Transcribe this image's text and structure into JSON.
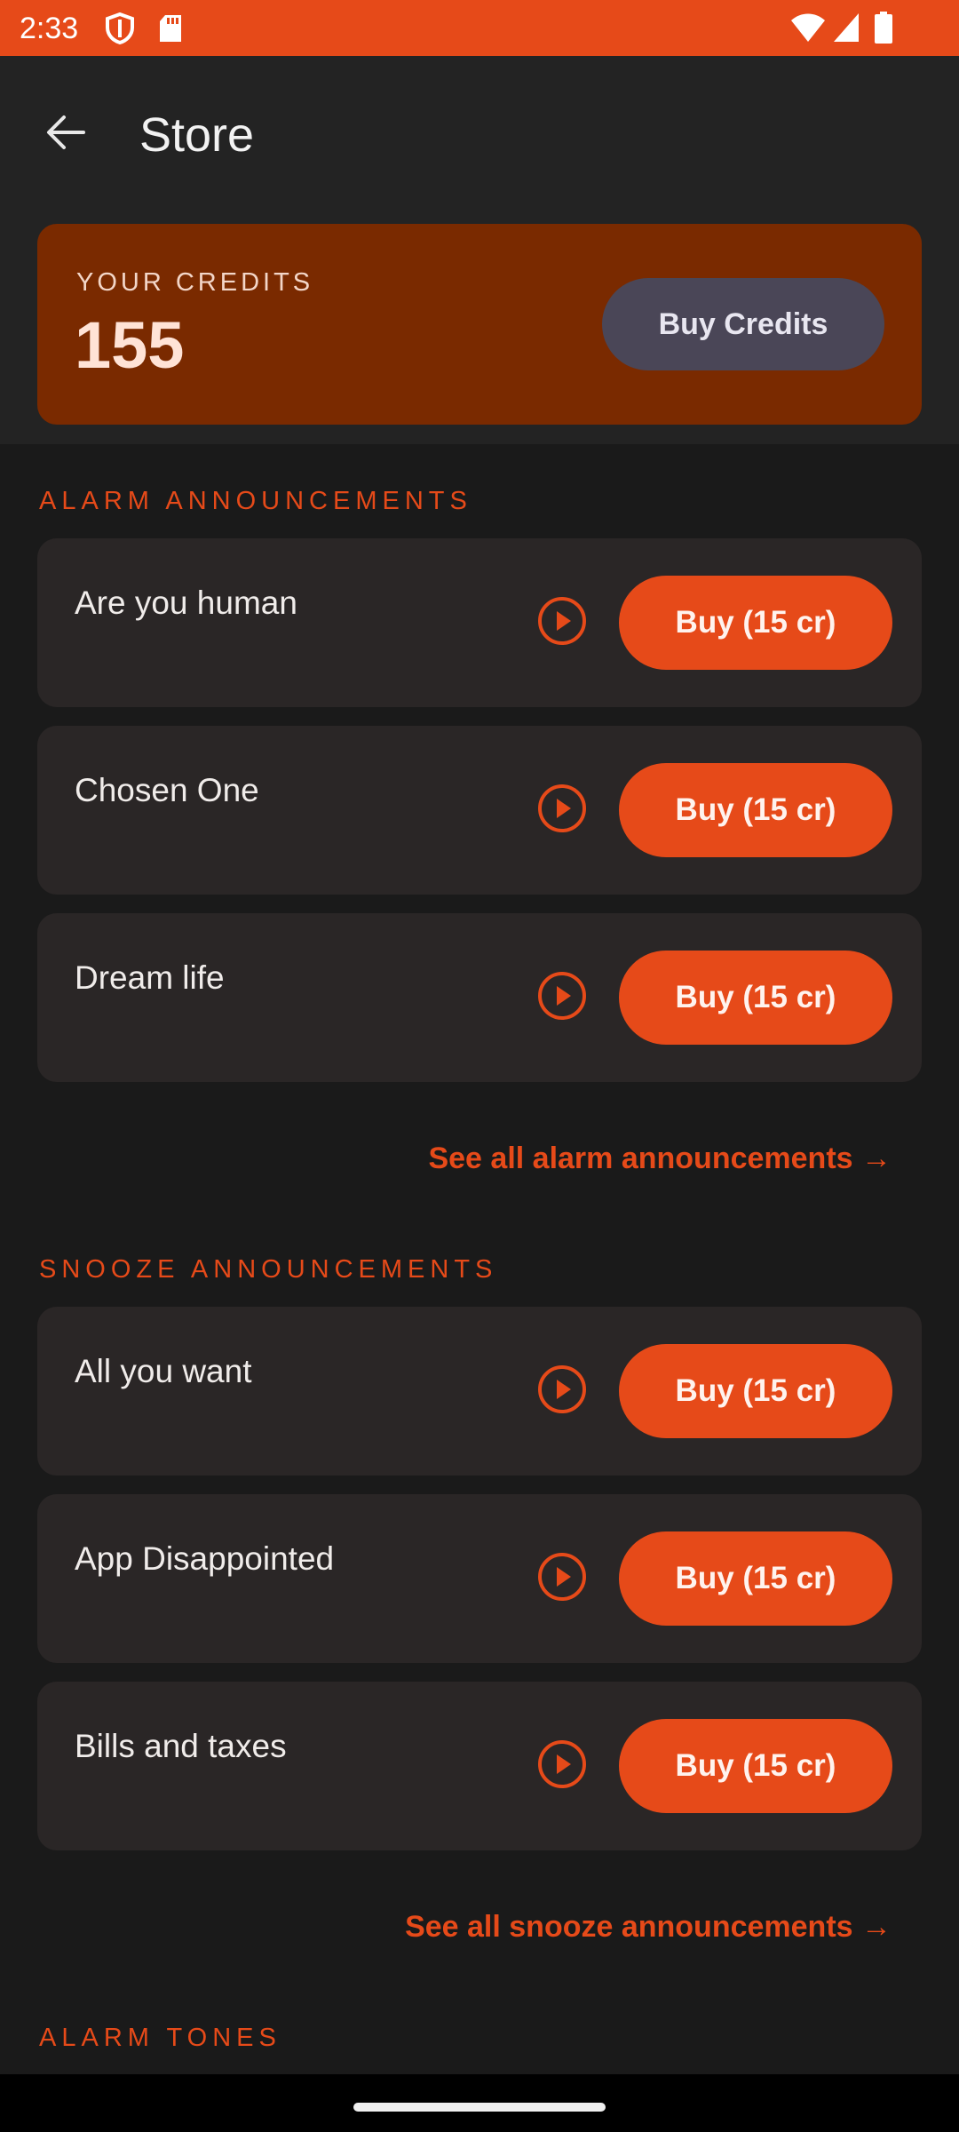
{
  "status_bar": {
    "time": "2:33",
    "icons": [
      "shield-icon",
      "sd-card-icon",
      "wifi-icon",
      "signal-icon",
      "battery-icon"
    ]
  },
  "app_bar": {
    "title": "Store",
    "back_icon": "arrow-left-icon"
  },
  "credits": {
    "label": "YOUR CREDITS",
    "value": "155",
    "buy_label": "Buy Credits"
  },
  "sections": {
    "alarm_announcements": {
      "header": "ALARM ANNOUNCEMENTS",
      "items": [
        {
          "title": "Are you human",
          "buy_label": "Buy (15 cr)"
        },
        {
          "title": "Chosen One",
          "buy_label": "Buy (15 cr)"
        },
        {
          "title": "Dream life",
          "buy_label": "Buy (15 cr)"
        }
      ],
      "see_all": "See all alarm announcements →"
    },
    "snooze_announcements": {
      "header": "SNOOZE ANNOUNCEMENTS",
      "items": [
        {
          "title": "All you want",
          "buy_label": "Buy (15 cr)"
        },
        {
          "title": "App Disappointed",
          "buy_label": "Buy (15 cr)"
        },
        {
          "title": "Bills and taxes",
          "buy_label": "Buy (15 cr)"
        }
      ],
      "see_all": "See all snooze announcements →"
    },
    "alarm_tones": {
      "header": "ALARM TONES"
    }
  },
  "colors": {
    "accent": "#e64a19",
    "credits_card": "#7a2a00",
    "card": "#2a2626",
    "background": "#1a1a1a",
    "app_bar": "#232323"
  }
}
